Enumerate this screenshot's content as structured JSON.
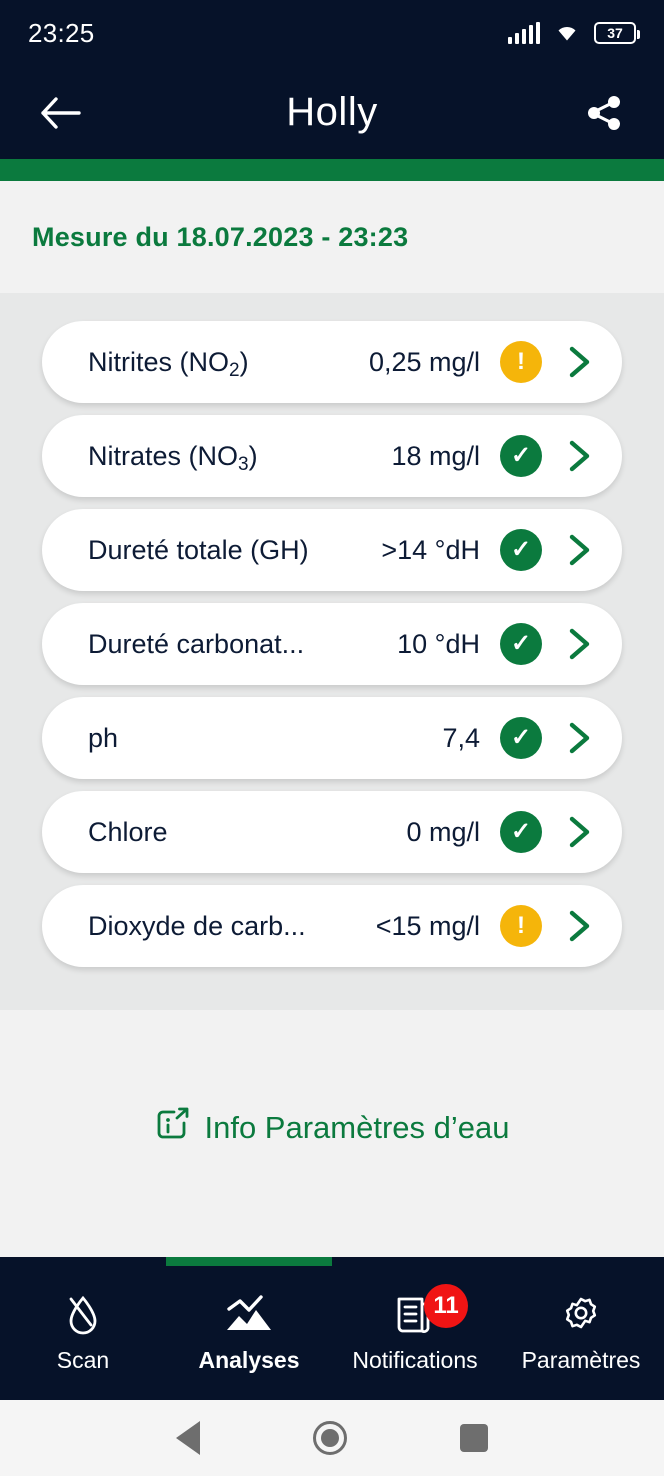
{
  "status_bar": {
    "time": "23:25",
    "battery_level": "37",
    "signal_icon": "cellular-signal-icon",
    "wifi_icon": "wifi-icon",
    "battery_icon": "battery-icon"
  },
  "app_bar": {
    "title": "Holly",
    "back_icon": "back-arrow-icon",
    "share_icon": "share-icon"
  },
  "measure": {
    "label": "Mesure du 18.07.2023 - 23:23"
  },
  "colors": {
    "header_bg": "#061229",
    "accent_green": "#0b7a3e",
    "warning_amber": "#f5b50a",
    "badge_red": "#f01414",
    "page_bg": "#f2f2f2",
    "list_bg": "#e7e8e8",
    "card_bg": "#ffffff",
    "text_dark": "#0d1b35"
  },
  "measurements": [
    {
      "name_main": "Nitrites (NO",
      "name_sub": "2",
      "name_tail": ")",
      "value": "0,25 mg/l",
      "status": "warn",
      "status_mark": "!",
      "status_icon": "warning-icon",
      "chevron_icon": "chevron-right-icon"
    },
    {
      "name_main": "Nitrates (NO",
      "name_sub": "3",
      "name_tail": ")",
      "value": "18 mg/l",
      "status": "ok",
      "status_mark": "✓",
      "status_icon": "check-icon",
      "chevron_icon": "chevron-right-icon"
    },
    {
      "name_main": "Dureté totale (GH)",
      "name_sub": "",
      "name_tail": "",
      "value": ">14 °dH",
      "status": "ok",
      "status_mark": "✓",
      "status_icon": "check-icon",
      "chevron_icon": "chevron-right-icon"
    },
    {
      "name_main": "Dureté carbonat...",
      "name_sub": "",
      "name_tail": "",
      "value": "10 °dH",
      "status": "ok",
      "status_mark": "✓",
      "status_icon": "check-icon",
      "chevron_icon": "chevron-right-icon"
    },
    {
      "name_main": "ph",
      "name_sub": "",
      "name_tail": "",
      "value": "7,4",
      "status": "ok",
      "status_mark": "✓",
      "status_icon": "check-icon",
      "chevron_icon": "chevron-right-icon"
    },
    {
      "name_main": "Chlore",
      "name_sub": "",
      "name_tail": "",
      "value": "0 mg/l",
      "status": "ok",
      "status_mark": "✓",
      "status_icon": "check-icon",
      "chevron_icon": "chevron-right-icon"
    },
    {
      "name_main": "Dioxyde de carb...",
      "name_sub": "",
      "name_tail": "",
      "value": "<15 mg/l",
      "status": "warn",
      "status_mark": "!",
      "status_icon": "warning-icon",
      "chevron_icon": "chevron-right-icon"
    }
  ],
  "info_link": {
    "label": "Info Paramètres d’eau",
    "icon": "info-external-link-icon"
  },
  "bottom_nav": {
    "active_index": 1,
    "items": [
      {
        "label": "Scan",
        "icon": "water-drop-scan-icon",
        "badge": ""
      },
      {
        "label": "Analyses",
        "icon": "chart-mountain-icon",
        "badge": ""
      },
      {
        "label": "Notifications",
        "icon": "document-icon",
        "badge": "11"
      },
      {
        "label": "Paramètres",
        "icon": "gear-icon",
        "badge": ""
      }
    ]
  },
  "system_nav": {
    "back_icon": "android-back-icon",
    "home_icon": "android-home-icon",
    "recents_icon": "android-recents-icon"
  }
}
